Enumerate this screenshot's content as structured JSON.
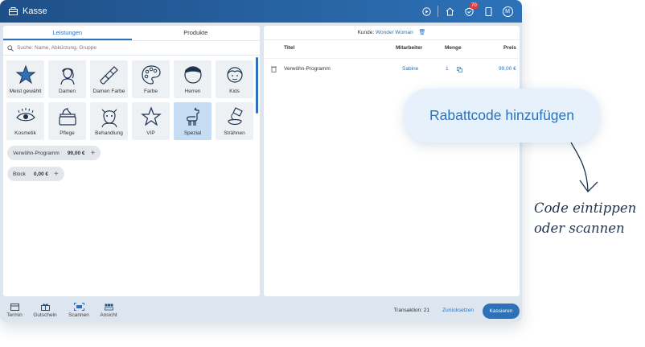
{
  "topbar": {
    "title": "Kasse",
    "badge_count": "70",
    "avatar_initial": "M",
    "icons": [
      "play-circle-icon",
      "store-icon",
      "shield-badge-icon",
      "tablet-icon"
    ]
  },
  "left": {
    "tabs": [
      {
        "label": "Leistungen",
        "active": true
      },
      {
        "label": "Produkte",
        "active": false
      }
    ],
    "search": {
      "placeholder": "Suche: Name, Abkürzung, Gruppe"
    },
    "categories": [
      {
        "label": "Meist gewählt",
        "icon": "star-icon"
      },
      {
        "label": "Damen",
        "icon": "woman-icon"
      },
      {
        "label": "Damen Farbe",
        "icon": "brush-icon"
      },
      {
        "label": "Farbe",
        "icon": "palette-icon"
      },
      {
        "label": "Herren",
        "icon": "man-icon"
      },
      {
        "label": "Kids",
        "icon": "child-icon"
      },
      {
        "label": "Kosmetik",
        "icon": "eye-icon"
      },
      {
        "label": "Pflege",
        "icon": "cream-jar-icon"
      },
      {
        "label": "Behandlung",
        "icon": "treatment-icon"
      },
      {
        "label": "VIP",
        "icon": "vip-star-icon"
      },
      {
        "label": "Spezial",
        "icon": "llama-icon",
        "selected": true
      },
      {
        "label": "Strähnen",
        "icon": "pour-icon"
      }
    ],
    "chips": [
      {
        "label": "Verwöhn-Programm",
        "price": "99,00 €"
      },
      {
        "label": "Block",
        "price": "0,00 €"
      }
    ]
  },
  "right": {
    "kunde_label": "Kunde:",
    "kunde_name": "Wonder Woman",
    "headers": {
      "titel": "Titel",
      "mitarbeiter": "Mitarbeiter",
      "menge": "Menge",
      "preis": "Preis"
    },
    "rows": [
      {
        "titel": "Verwöhn-Programm",
        "mitarbeiter": "Sabine",
        "menge": "1",
        "preis": "99,00 €"
      }
    ]
  },
  "bottom": {
    "nav": [
      {
        "label": "Termin",
        "icon": "calendar-icon"
      },
      {
        "label": "Gutschein",
        "icon": "gift-icon"
      },
      {
        "label": "Scannen",
        "icon": "scan-icon"
      },
      {
        "label": "Ansicht",
        "icon": "grid-view-icon"
      }
    ],
    "transaktion": "Transaktion: 21",
    "reset": "Zurücksetzen",
    "checkout": "Kassieren"
  },
  "callout": {
    "text": "Rabattcode hinzufügen"
  },
  "annotation": {
    "line1": "Code eintippen",
    "line2": "oder scannen"
  },
  "colors": {
    "accent": "#2d72b8",
    "header_dark": "#1f4f87",
    "selected_tile": "#c5dcf2",
    "badge": "#e23b3b"
  }
}
